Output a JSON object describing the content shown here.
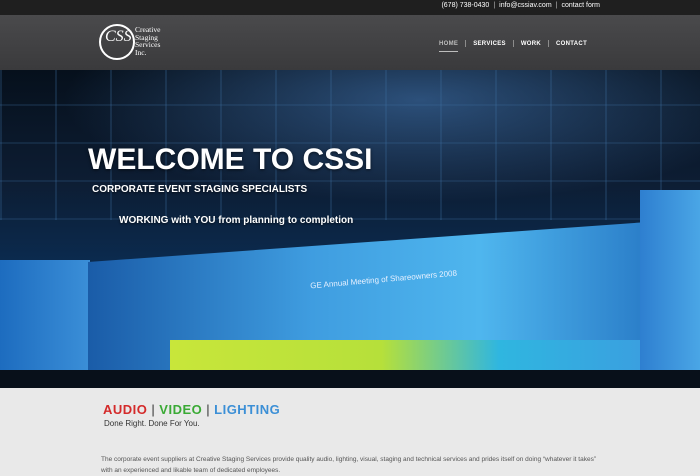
{
  "contact": {
    "phone": "(678) 738-0430",
    "email": "info@cssiav.com",
    "form_label": "contact form"
  },
  "logo": {
    "mark": "CSS",
    "lines": [
      "Creative",
      "Staging",
      "Services",
      "Inc."
    ]
  },
  "nav": {
    "items": [
      {
        "label": "HOME"
      },
      {
        "label": "SERVICES"
      },
      {
        "label": "WORK"
      },
      {
        "label": "CONTACT"
      }
    ]
  },
  "hero": {
    "title": "WELCOME TO CSSI",
    "subtitle": "CORPORATE EVENT STAGING SPECIALISTS",
    "tagline": "WORKING with YOU from planning to completion",
    "stage_sign": "GE Annual Meeting of Shareowners 2008"
  },
  "services": {
    "items": [
      {
        "label": "AUDIO",
        "color": "#d42a2a"
      },
      {
        "label": "VIDEO",
        "color": "#3aaa35"
      },
      {
        "label": "LIGHTING",
        "color": "#3b8fd6"
      }
    ],
    "separator": "|",
    "tagline": "Done Right. Done For You."
  },
  "about": {
    "text": "The corporate event suppliers at Creative Staging Services provide quality audio, lighting, visual, staging and technical services and prides itself on doing “whatever it takes” with an experienced and likable team of dedicated employees."
  }
}
